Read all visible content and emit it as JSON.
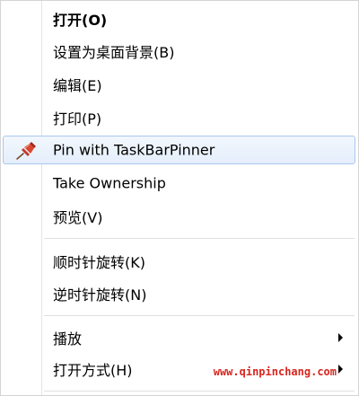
{
  "context_menu": {
    "items": [
      {
        "label": "打开(O)"
      },
      {
        "label": "设置为桌面背景(B)"
      },
      {
        "label": "编辑(E)"
      },
      {
        "label": "打印(P)"
      },
      {
        "label": "Pin with TaskBarPinner",
        "icon": "pushpin-icon"
      },
      {
        "label": "Take Ownership"
      },
      {
        "label": "预览(V)"
      },
      {
        "label": "顺时针旋转(K)"
      },
      {
        "label": "逆时针旋转(N)"
      },
      {
        "label": "播放",
        "submenu": true
      },
      {
        "label": "打开方式(H)",
        "submenu": true
      }
    ],
    "hover_color": "#a8c8ee"
  },
  "watermark": {
    "text": "www.qinpinchang.com",
    "color": "#d7261e"
  }
}
